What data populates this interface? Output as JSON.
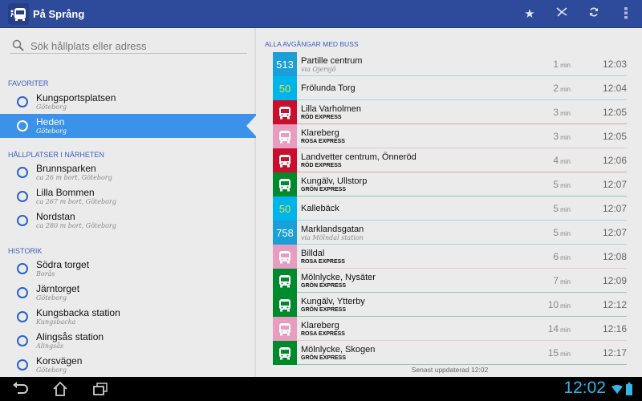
{
  "app": {
    "title": "På Språng"
  },
  "actions": [
    {
      "icon": "star-icon"
    },
    {
      "icon": "map-icon"
    },
    {
      "icon": "refresh-icon"
    },
    {
      "icon": "overflow-menu-icon"
    }
  ],
  "search": {
    "placeholder": "Sök hållplats eller adress"
  },
  "sections": {
    "favorites": {
      "title": "FAVORITER",
      "items": [
        {
          "name": "Kungsportsplatsen",
          "sub": "Göteborg"
        },
        {
          "name": "Heden",
          "sub": "Göteborg",
          "selected": true
        }
      ]
    },
    "nearby": {
      "title": "HÅLLPLATSER I NÄRHETEN",
      "items": [
        {
          "name": "Brunnsparken",
          "sub": "ca 26 m bort, Göteborg"
        },
        {
          "name": "Lilla Bommen",
          "sub": "ca 267 m bort, Göteborg"
        },
        {
          "name": "Nordstan",
          "sub": "ca 280 m bort, Göteborg"
        }
      ]
    },
    "history": {
      "title": "HISTORIK",
      "items": [
        {
          "name": "Södra torget",
          "sub": "Borås"
        },
        {
          "name": "Järntorget",
          "sub": "Göteborg"
        },
        {
          "name": "Kungsbacka station",
          "sub": "Kungsbacka"
        },
        {
          "name": "Alingsås station",
          "sub": "Alingsås"
        },
        {
          "name": "Korsvägen",
          "sub": "Göteborg"
        }
      ]
    }
  },
  "departures": {
    "title": "ALLA AVGÅNGAR MED BUSS",
    "min_label": "min",
    "rows": [
      {
        "line": "513",
        "dest": "Partille centrum",
        "via": "via Ojersjö",
        "min": "1",
        "time": "12:03",
        "color": "#1a9fd8",
        "fg": "#ffffff",
        "sep": "#9fd3ef"
      },
      {
        "line": "50",
        "dest": "Frölunda Torg",
        "min": "2",
        "time": "12:04",
        "color": "#00b5ec",
        "fg": "#e3e33a",
        "sep": "#9fd3ef"
      },
      {
        "line": "",
        "dest": "Lilla Varholmen",
        "express": "RÖD EXPRESS",
        "min": "3",
        "time": "12:05",
        "color": "#c8102e",
        "sep": "#e1a0a8"
      },
      {
        "line": "",
        "dest": "Klareberg",
        "express": "ROSA EXPRESS",
        "min": "3",
        "time": "12:05",
        "color": "#e89cc0",
        "sep": "#eec3d5"
      },
      {
        "line": "",
        "dest": "Landvetter centrum, Önneröd",
        "express": "RÖD EXPRESS",
        "min": "4",
        "time": "12:06",
        "color": "#c8102e",
        "sep": "#e1a0a8"
      },
      {
        "line": "",
        "dest": "Kungälv, Ullstorp",
        "express": "GRÖN EXPRESS",
        "min": "5",
        "time": "12:07",
        "color": "#008a2e",
        "sep": "#9cc8a5"
      },
      {
        "line": "50",
        "dest": "Kallebäck",
        "min": "5",
        "time": "12:07",
        "color": "#00b5ec",
        "fg": "#e3e33a",
        "sep": "#9fd3ef"
      },
      {
        "line": "758",
        "dest": "Marklandsgatan",
        "via": "via Mölndal station",
        "min": "5",
        "time": "12:07",
        "color": "#1a9fd8",
        "fg": "#ffffff",
        "sep": "#9fd3ef"
      },
      {
        "line": "",
        "dest": "Billdal",
        "express": "ROSA EXPRESS",
        "min": "6",
        "time": "12:08",
        "color": "#e89cc0",
        "sep": "#eec3d5"
      },
      {
        "line": "",
        "dest": "Mölnlycke, Nysäter",
        "express": "GRÖN EXPRESS",
        "min": "7",
        "time": "12:09",
        "color": "#008a2e",
        "sep": "#9cc8a5"
      },
      {
        "line": "",
        "dest": "Kungälv, Ytterby",
        "express": "GRÖN EXPRESS",
        "min": "10",
        "time": "12:12",
        "color": "#008a2e",
        "sep": "#9cc8a5"
      },
      {
        "line": "",
        "dest": "Klareberg",
        "express": "ROSA EXPRESS",
        "min": "14",
        "time": "12:16",
        "color": "#e89cc0",
        "sep": "#eec3d5"
      },
      {
        "line": "",
        "dest": "Mölnlycke, Skogen",
        "express": "GRÖN EXPRESS",
        "min": "15",
        "time": "12:17",
        "color": "#008a2e",
        "sep": "#9cc8a5"
      }
    ],
    "footer": "Senast uppdaterad 12:02"
  },
  "status": {
    "clock": "12:02"
  },
  "colors": {
    "header": "#2e4a9a",
    "selected": "#3b92e8",
    "accent": "#3a5fbf"
  }
}
